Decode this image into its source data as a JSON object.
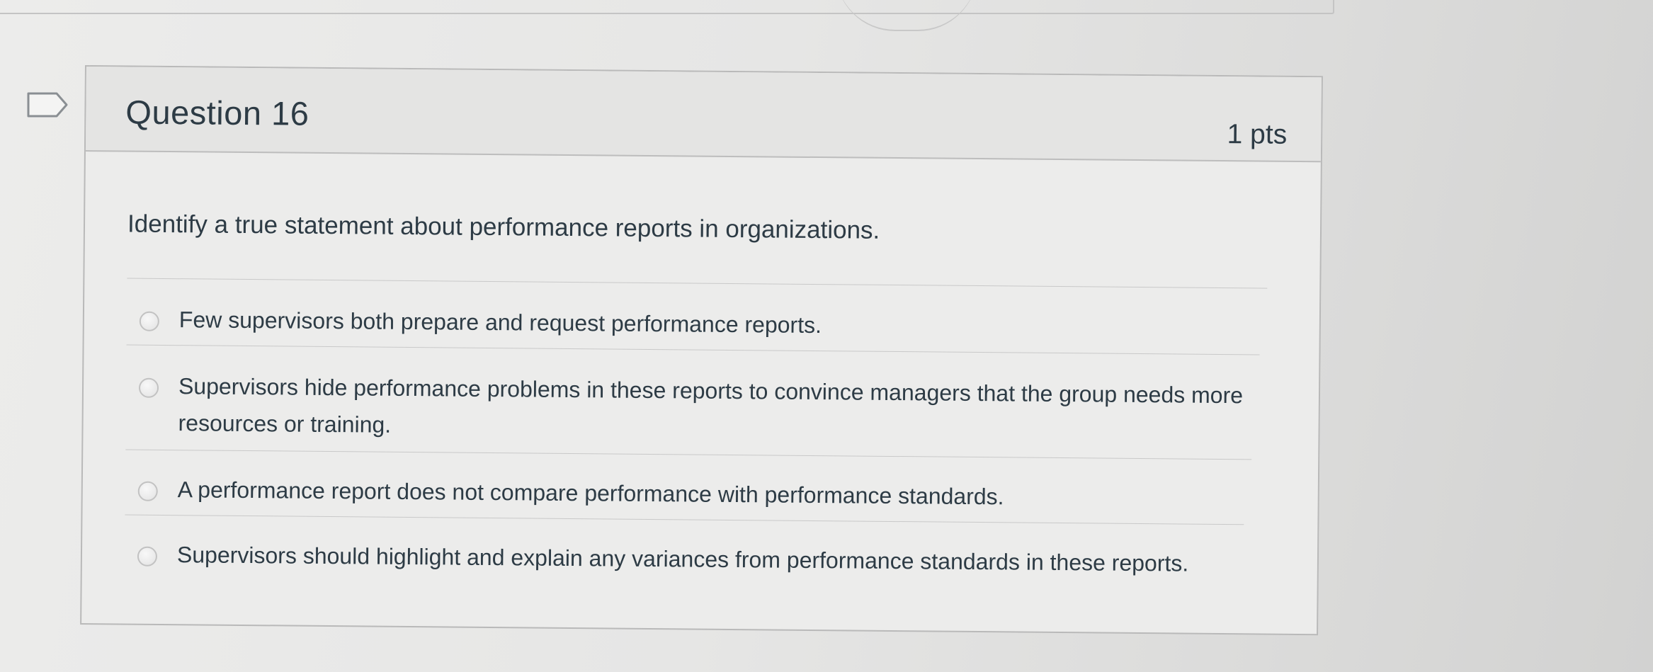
{
  "question": {
    "title": "Question 16",
    "points": "1 pts",
    "text": "Identify a true statement about performance reports in organizations."
  },
  "answers": [
    {
      "label": "Few supervisors both prepare and request performance reports.",
      "selected": false
    },
    {
      "label": "Supervisors hide performance problems in these reports to convince managers that the group needs more resources or training.",
      "selected": false
    },
    {
      "label": "A performance report does not compare performance with performance standards.",
      "selected": false
    },
    {
      "label": "Supervisors should highlight and explain any variances from performance standards in these reports.",
      "selected": false
    }
  ],
  "icons": {
    "flag": "flag-question-icon",
    "radio": "radio-button-icon"
  },
  "colors": {
    "text": "#2d3b45",
    "background": "#e6e6e5",
    "border": "#b9b9b9"
  }
}
